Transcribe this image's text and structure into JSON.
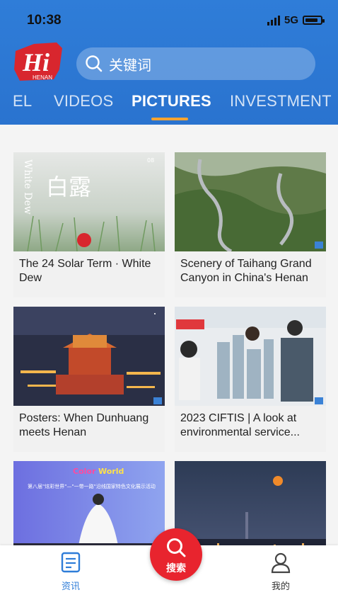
{
  "status": {
    "time": "10:38",
    "network": "5G"
  },
  "header": {
    "logo_text": "Hi",
    "logo_sub": "HENAN",
    "search_placeholder": "关键词"
  },
  "tabs": [
    {
      "label": "EL"
    },
    {
      "label": "VIDEOS"
    },
    {
      "label": "PICTURES",
      "active": true
    },
    {
      "label": "INVESTMENT"
    }
  ],
  "cards": [
    {
      "title": "The 24 Solar Term · White Dew",
      "img_text_cn": "白露",
      "img_text_en": "White Dew",
      "img_num": "08"
    },
    {
      "title": "Scenery of Taihang Grand Canyon in China's Henan"
    },
    {
      "title": "Posters: When Dunhuang meets Henan"
    },
    {
      "title": "2023 CIFTIS | A look at environmental service..."
    },
    {
      "title": "",
      "img_text": "第八届\"炫彩世界\"—\"一带一路\"沿线国家特色文化展示活动"
    },
    {
      "title": ""
    }
  ],
  "bottom_nav": {
    "news": "资讯",
    "search": "搜索",
    "mine": "我的"
  },
  "colors": {
    "header": "#2f7dd8",
    "accent": "#f5a431",
    "fab": "#e8242e",
    "nav_active": "#2f7dd8"
  }
}
